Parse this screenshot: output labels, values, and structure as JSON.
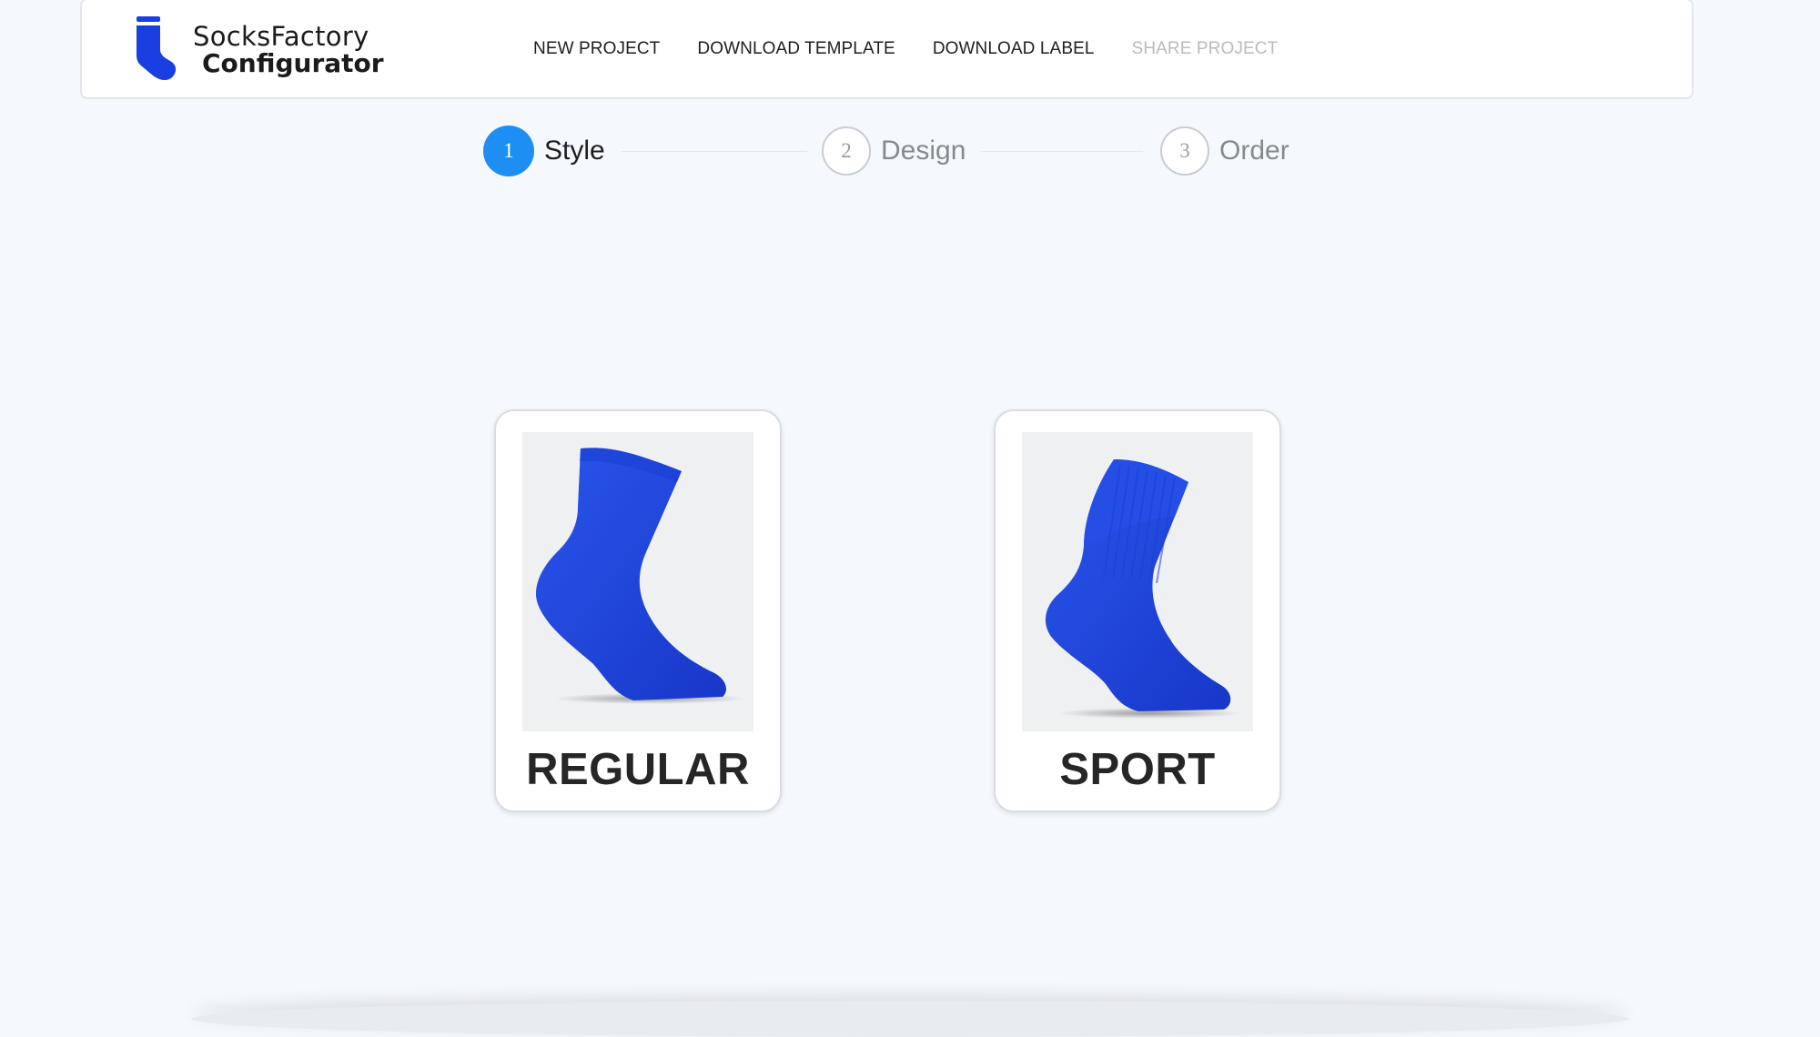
{
  "brand": {
    "line1": "SocksFactory",
    "line2": "Configurator",
    "accent_color": "#1a3fe0",
    "logo_icon": "sock-logo-icon"
  },
  "nav": {
    "items": [
      {
        "label": "NEW PROJECT",
        "enabled": true
      },
      {
        "label": "DOWNLOAD TEMPLATE",
        "enabled": true
      },
      {
        "label": "DOWNLOAD LABEL",
        "enabled": true
      },
      {
        "label": "SHARE PROJECT",
        "enabled": false
      }
    ]
  },
  "stepper": {
    "active_color": "#1d8ef2",
    "steps": [
      {
        "number": "1",
        "label": "Style",
        "active": true
      },
      {
        "number": "2",
        "label": "Design",
        "active": false
      },
      {
        "number": "3",
        "label": "Order",
        "active": false
      }
    ]
  },
  "styles": {
    "options": [
      {
        "label": "REGULAR",
        "image": "regular-sock-image",
        "color": "#1f47e0"
      },
      {
        "label": "SPORT",
        "image": "sport-sock-image",
        "color": "#1f47e0"
      }
    ]
  }
}
